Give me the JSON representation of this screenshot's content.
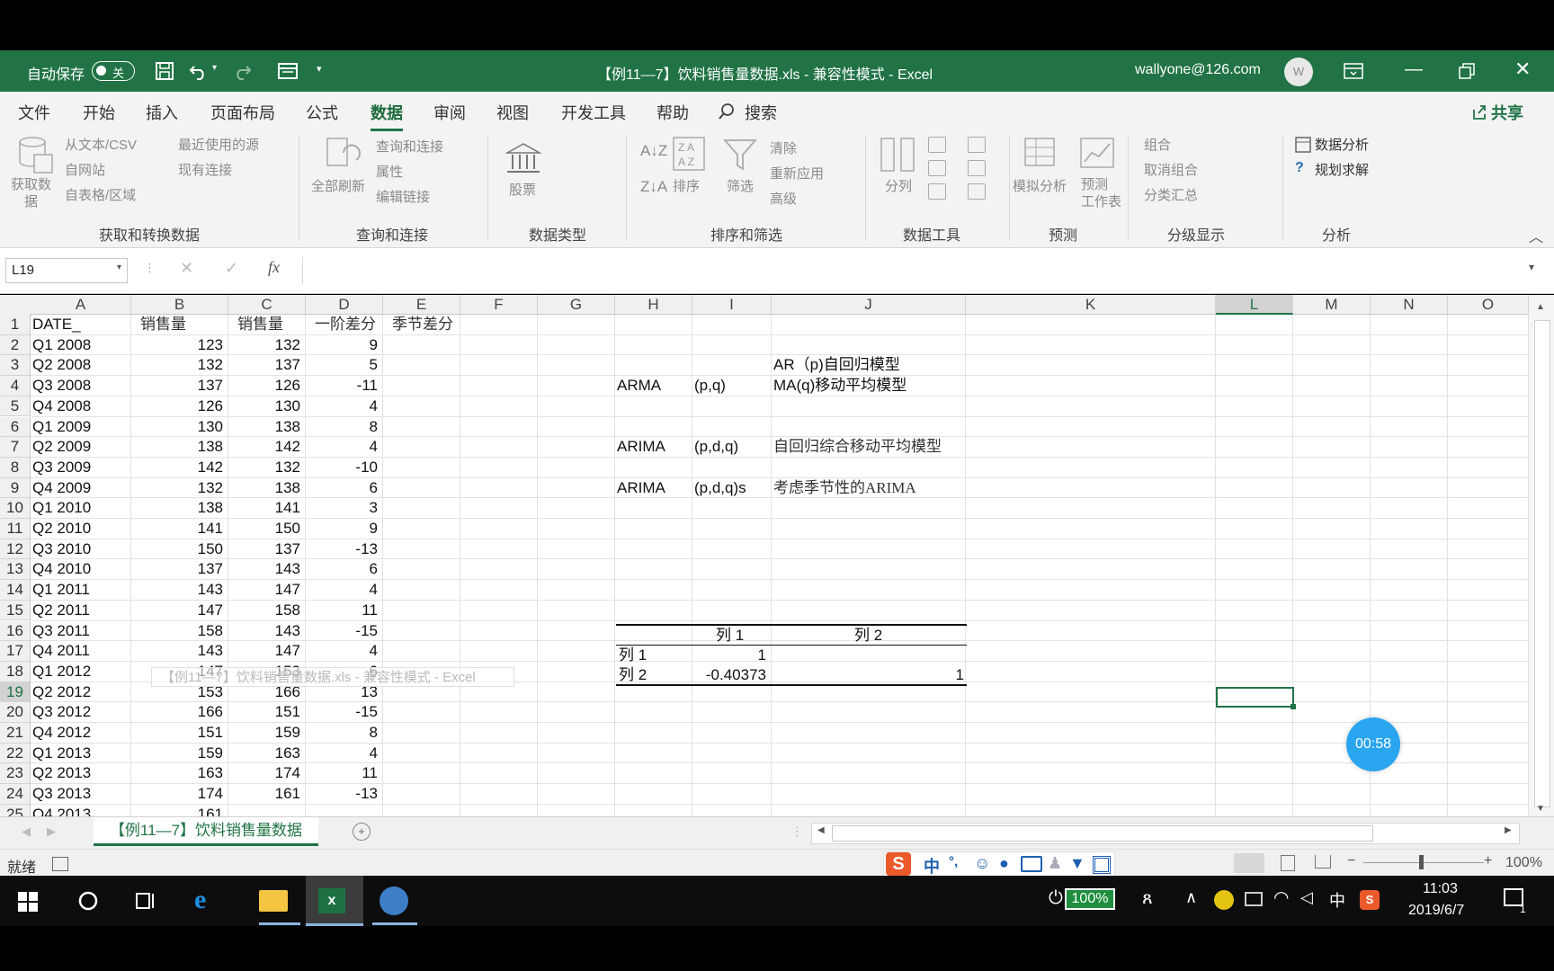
{
  "title_bar": {
    "autosave_label": "自动保存",
    "autosave_state": "关",
    "document_title": "【例11—7】饮料销售量数据.xls  -  兼容性模式  -  Excel",
    "account": "wallyone@126.com",
    "avatar_initial": "W"
  },
  "menu_tabs": [
    "文件",
    "开始",
    "插入",
    "页面布局",
    "公式",
    "数据",
    "审阅",
    "视图",
    "开发工具",
    "帮助"
  ],
  "search_label": "搜索",
  "share_label": "共享",
  "ribbon": {
    "get_data": "获取数\n据",
    "from_text_csv": "从文本/CSV",
    "from_web": "自网站",
    "from_table": "自表格/区域",
    "recent_sources": "最近使用的源",
    "existing_connections": "现有连接",
    "group_get_transform": "获取和转换数据",
    "refresh_all": "全部刷新",
    "queries_connections": "查询和连接",
    "properties": "属性",
    "edit_links": "编辑链接",
    "group_queries": "查询和连接",
    "stocks": "股票",
    "group_data_types": "数据类型",
    "sort": "排序",
    "filter": "筛选",
    "clear": "清除",
    "reapply": "重新应用",
    "advanced": "高级",
    "group_sort_filter": "排序和筛选",
    "text_to_columns": "分列",
    "group_data_tools": "数据工具",
    "what_if": "模拟分析",
    "forecast_sheet": "预测\n工作表",
    "group_forecast": "预测",
    "group_items": "组合",
    "ungroup": "取消组合",
    "subtotal": "分类汇总",
    "group_outline": "分级显示",
    "data_analysis": "数据分析",
    "solver": "规划求解",
    "group_analysis": "分析"
  },
  "name_box": "L19",
  "fx_label": "fx",
  "columns": [
    "A",
    "B",
    "C",
    "D",
    "E",
    "F",
    "G",
    "H",
    "I",
    "J",
    "K",
    "L",
    "M",
    "N",
    "O"
  ],
  "selected_column": "L",
  "selected_row": 19,
  "rows": [
    {
      "n": "1",
      "a": "DATE_",
      "b": "销售量",
      "c": "销售量",
      "d": "一阶差分",
      "e": "季节差分"
    },
    {
      "n": "2",
      "a": "Q1 2008",
      "b": "123",
      "c": "132",
      "d": "9"
    },
    {
      "n": "3",
      "a": "Q2 2008",
      "b": "132",
      "c": "137",
      "d": "5"
    },
    {
      "n": "4",
      "a": "Q3 2008",
      "b": "137",
      "c": "126",
      "d": "-11"
    },
    {
      "n": "5",
      "a": "Q4 2008",
      "b": "126",
      "c": "130",
      "d": "4"
    },
    {
      "n": "6",
      "a": "Q1 2009",
      "b": "130",
      "c": "138",
      "d": "8"
    },
    {
      "n": "7",
      "a": "Q2 2009",
      "b": "138",
      "c": "142",
      "d": "4"
    },
    {
      "n": "8",
      "a": "Q3 2009",
      "b": "142",
      "c": "132",
      "d": "-10"
    },
    {
      "n": "9",
      "a": "Q4 2009",
      "b": "132",
      "c": "138",
      "d": "6"
    },
    {
      "n": "10",
      "a": "Q1 2010",
      "b": "138",
      "c": "141",
      "d": "3"
    },
    {
      "n": "11",
      "a": "Q2 2010",
      "b": "141",
      "c": "150",
      "d": "9"
    },
    {
      "n": "12",
      "a": "Q3 2010",
      "b": "150",
      "c": "137",
      "d": "-13"
    },
    {
      "n": "13",
      "a": "Q4 2010",
      "b": "137",
      "c": "143",
      "d": "6"
    },
    {
      "n": "14",
      "a": "Q1 2011",
      "b": "143",
      "c": "147",
      "d": "4"
    },
    {
      "n": "15",
      "a": "Q2 2011",
      "b": "147",
      "c": "158",
      "d": "11"
    },
    {
      "n": "16",
      "a": "Q3 2011",
      "b": "158",
      "c": "143",
      "d": "-15"
    },
    {
      "n": "17",
      "a": "Q4 2011",
      "b": "143",
      "c": "147",
      "d": "4"
    },
    {
      "n": "18",
      "a": "Q1 2012",
      "b": "147",
      "c": "153",
      "d": "6"
    },
    {
      "n": "19",
      "a": "Q2 2012",
      "b": "153",
      "c": "166",
      "d": "13"
    },
    {
      "n": "20",
      "a": "Q3 2012",
      "b": "166",
      "c": "151",
      "d": "-15"
    },
    {
      "n": "21",
      "a": "Q4 2012",
      "b": "151",
      "c": "159",
      "d": "8"
    },
    {
      "n": "22",
      "a": "Q1 2013",
      "b": "159",
      "c": "163",
      "d": "4"
    },
    {
      "n": "23",
      "a": "Q2 2013",
      "b": "163",
      "c": "174",
      "d": "11"
    },
    {
      "n": "24",
      "a": "Q3 2013",
      "b": "174",
      "c": "161",
      "d": "-13"
    },
    {
      "n": "25",
      "a": "Q4 2013",
      "b": "161",
      "c": "",
      "d": ""
    }
  ],
  "notes": [
    {
      "row": 3,
      "h": "",
      "i": "",
      "j": "AR（p)自回归模型"
    },
    {
      "row": 4,
      "h": "ARMA",
      "i": "(p,q)",
      "j": "MA(q)移动平均模型"
    },
    {
      "row": 7,
      "h": "ARIMA",
      "i": "(p,d,q)",
      "j": "自回归综合移动平均模型"
    },
    {
      "row": 9,
      "h": "ARIMA",
      "i": "(p,d,q)s",
      "j": "考虑季节性的ARIMA"
    }
  ],
  "corr_table": {
    "col1": "列 1",
    "col2": "列 2",
    "row1_label": "列 1",
    "row1_val": "1",
    "row2_label": "列 2",
    "row2_val1": "-0.40373",
    "row2_val2": "1"
  },
  "tooltip": "【例11—7】饮料销售量数据.xls - 兼容性模式 - Excel",
  "timer": "00:58",
  "sheet_tab": "【例11—7】饮料销售量数据",
  "status_ready": "就绪",
  "zoom": "100%",
  "ime_chars": [
    "中",
    "°,"
  ],
  "taskbar": {
    "battery": "100%",
    "time": "11:03",
    "date": "2019/6/7",
    "ime": "中",
    "notif_count": "1"
  }
}
